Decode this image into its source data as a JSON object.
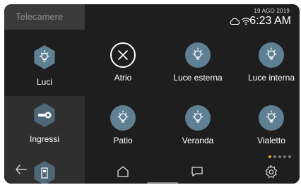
{
  "sidebar": {
    "title": "Telecamere",
    "items": [
      {
        "label": "Luci",
        "icon": "lightbulb-icon",
        "active": true
      },
      {
        "label": "Ingressi",
        "icon": "key-toggle-icon",
        "active": false
      }
    ],
    "back_icon": "arrow-left-icon",
    "door_icon": "door-icon"
  },
  "status": {
    "date": "19 AGO 2019",
    "time": "6:23 AM",
    "icons": [
      "cloud-icon",
      "wifi-icon"
    ]
  },
  "tiles": [
    {
      "label": "Atrio",
      "icon": "close-icon",
      "state": "off"
    },
    {
      "label": "Luce esterna",
      "icon": "lightbulb-icon",
      "state": "on"
    },
    {
      "label": "Luce interna",
      "icon": "lightbulb-icon",
      "state": "on"
    },
    {
      "label": "Patio",
      "icon": "lightbulb-icon",
      "state": "on"
    },
    {
      "label": "Veranda",
      "icon": "lightbulb-icon",
      "state": "on"
    },
    {
      "label": "Vialetto",
      "icon": "lightbulb-icon",
      "state": "on"
    }
  ],
  "pagination": {
    "current": 1,
    "total": 5
  },
  "bottom_nav": [
    "home-icon",
    "chat-icon",
    "settings-icon"
  ],
  "colors": {
    "accent": "#5f7f93",
    "page_dot": "#e8a52a",
    "background": "#1e1e1e",
    "rail": "#2f2f2f"
  }
}
